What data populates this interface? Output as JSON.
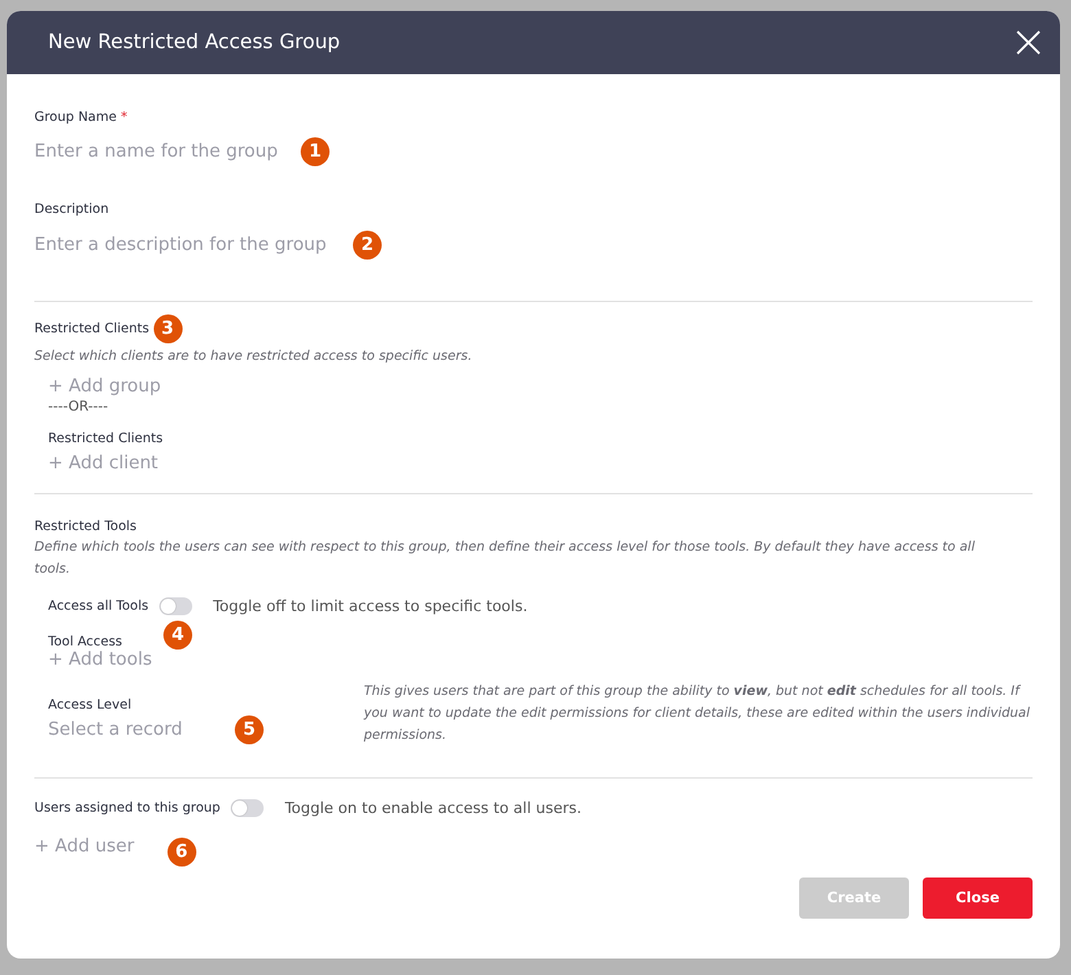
{
  "dialog": {
    "title": "New Restricted Access Group"
  },
  "group_name": {
    "label": "Group Name",
    "required_mark": "*",
    "placeholder": "Enter a name for the group",
    "callout": "1"
  },
  "description": {
    "label": "Description",
    "placeholder": "Enter a description for the group",
    "callout": "2"
  },
  "restricted_clients": {
    "heading": "Restricted Clients",
    "callout": "3",
    "hint": "Select which clients are to have restricted access to specific users.",
    "add_group": "+ Add group",
    "separator": "----OR----",
    "clients_label": "Restricted Clients",
    "add_client": "+ Add client"
  },
  "restricted_tools": {
    "heading": "Restricted Tools",
    "hint": "Define which tools the users can see with respect to this group, then define their access level for those tools. By default they have access to all tools.",
    "access_all": {
      "label": "Access all Tools",
      "on": false,
      "hint": "Toggle off to limit access to specific tools."
    },
    "tool_access_label": "Tool Access",
    "tool_access_callout": "4",
    "add_tools": "+ Add tools",
    "access_level": {
      "label": "Access Level",
      "placeholder": "Select a record",
      "callout": "5",
      "note": "This gives users that are part of this group the ability to **view**, but not **edit** schedules for all tools. If you want to update the edit permissions for client details, these are edited within the users individual permissions."
    }
  },
  "users": {
    "label": "Users assigned to this group",
    "on": false,
    "hint": "Toggle on to enable access to all users.",
    "add_user": "+ Add user",
    "callout": "6"
  },
  "buttons": [
    {
      "label": "Create",
      "kind": "primary",
      "disabled": true
    },
    {
      "label": "Close",
      "kind": "danger",
      "disabled": false
    }
  ]
}
